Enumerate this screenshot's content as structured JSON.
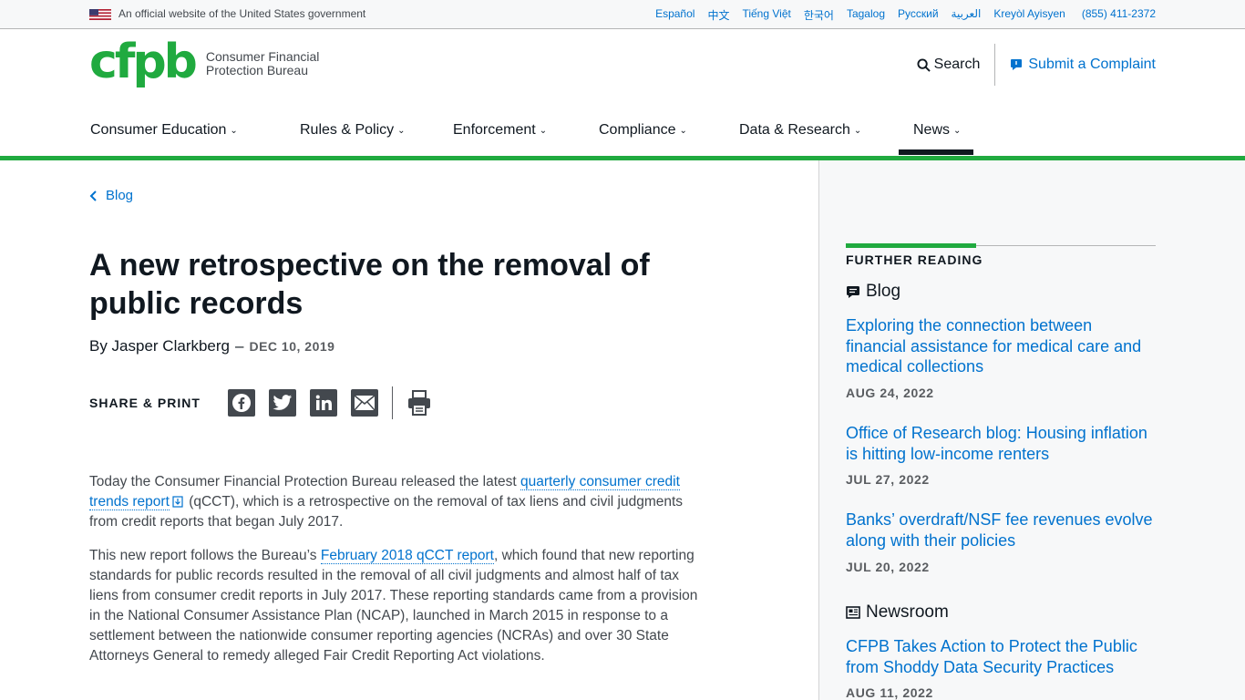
{
  "gov_banner": {
    "text": "An official website of the United States government",
    "languages": [
      "Español",
      "中文",
      "Tiếng Việt",
      "한국어",
      "Tagalog",
      "Русский",
      "العربية",
      "Kreyòl Ayisyen"
    ],
    "phone": "(855) 411-2372"
  },
  "header": {
    "logo_mark": "cfpb",
    "logo_line1": "Consumer Financial",
    "logo_line2": "Protection Bureau",
    "search_label": "Search",
    "complaint_label": "Submit a Complaint"
  },
  "nav": {
    "items": [
      "Consumer Education",
      "Rules & Policy",
      "Enforcement",
      "Compliance",
      "Data & Research",
      "News"
    ],
    "active": "News"
  },
  "article": {
    "breadcrumb": "Blog",
    "title": "A new retrospective on the removal of public records",
    "author": "By Jasper Clarkberg",
    "separator": "–",
    "date": "DEC 10, 2019",
    "share_label": "SHARE & PRINT",
    "p1_before": "Today the Consumer Financial Protection Bureau released the latest ",
    "p1_link": "quarterly consumer credit trends report",
    "p1_after": " (qCCT), which is a retrospective on the removal of tax liens and civil judgments from credit reports that began July 2017.",
    "p2_before": "This new report follows the Bureau’s ",
    "p2_link": "February 2018 qCCT report",
    "p2_after": ", which found that new reporting standards for public records resulted in the removal of all civil judgments and almost half of tax liens from consumer credit reports in July 2017. These reporting standards came from a provision in the National Consumer Assistance Plan (NCAP), launched in March 2015 in response to a settlement between the nationwide consumer reporting agencies (NCRAs) and over 30 State Attorneys General to remedy alleged Fair Credit Reporting Act violations."
  },
  "further_reading": {
    "heading": "FURTHER READING",
    "blog_label": "Blog",
    "blog_items": [
      {
        "title": "Exploring the connection between financial assistance for medical care and medical collections",
        "date": "AUG 24, 2022"
      },
      {
        "title": "Office of Research blog: Housing inflation is hitting low-income renters",
        "date": "JUL 27, 2022"
      },
      {
        "title": "Banks’ overdraft/NSF fee revenues evolve along with their policies",
        "date": "JUL 20, 2022"
      }
    ],
    "newsroom_label": "Newsroom",
    "newsroom_items": [
      {
        "title": "CFPB Takes Action to Protect the Public from Shoddy Data Security Practices",
        "date": "AUG 11, 2022"
      }
    ]
  },
  "colors": {
    "brand_green": "#20aa3f",
    "link_blue": "#0072ce",
    "text_dark": "#101820"
  }
}
